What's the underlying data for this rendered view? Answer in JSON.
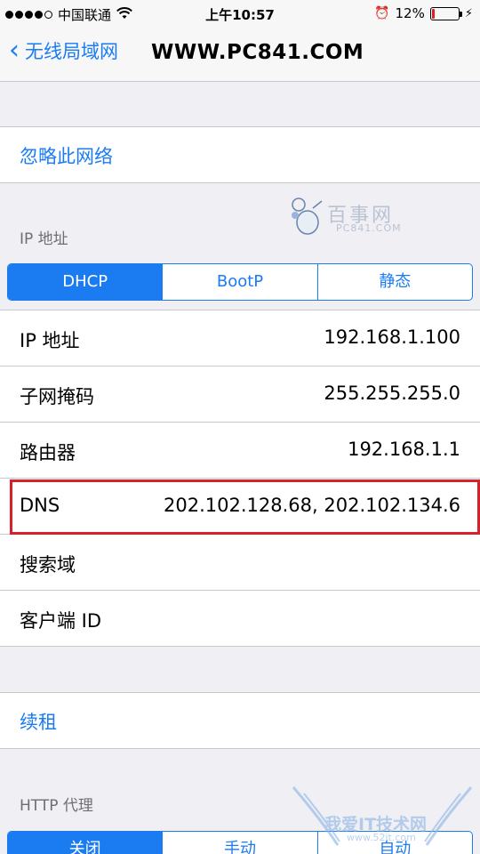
{
  "status_bar": {
    "carrier": "中国联通",
    "time": "上午10:57",
    "battery_percent": "12%",
    "battery_level": 0.12
  },
  "nav": {
    "back_label": "无线局域网",
    "title": "WWW.PC841.COM"
  },
  "forget_network": "忽略此网络",
  "ip_section": {
    "header": "IP 地址",
    "segments": [
      "DHCP",
      "BootP",
      "静态"
    ],
    "selected": "DHCP",
    "rows": [
      {
        "key": "IP 地址",
        "value": "192.168.1.100"
      },
      {
        "key": "子网掩码",
        "value": "255.255.255.0"
      },
      {
        "key": "路由器",
        "value": "192.168.1.1"
      },
      {
        "key": "DNS",
        "value": "202.102.128.68, 202.102.134.6"
      },
      {
        "key": "搜索域",
        "value": ""
      },
      {
        "key": "客户端 ID",
        "value": ""
      }
    ]
  },
  "renew_lease": "续租",
  "http_proxy": {
    "header": "HTTP 代理",
    "segments": [
      "关闭",
      "手动",
      "自动"
    ],
    "selected": "关闭"
  },
  "watermarks": {
    "top_text": "百事网",
    "top_sub": "PC841.COM",
    "bottom_text": "我爱IT技术网",
    "bottom_sub": "www.52it.com"
  },
  "colors": {
    "accent": "#1b7cf2",
    "highlight_border": "#d8202a"
  }
}
